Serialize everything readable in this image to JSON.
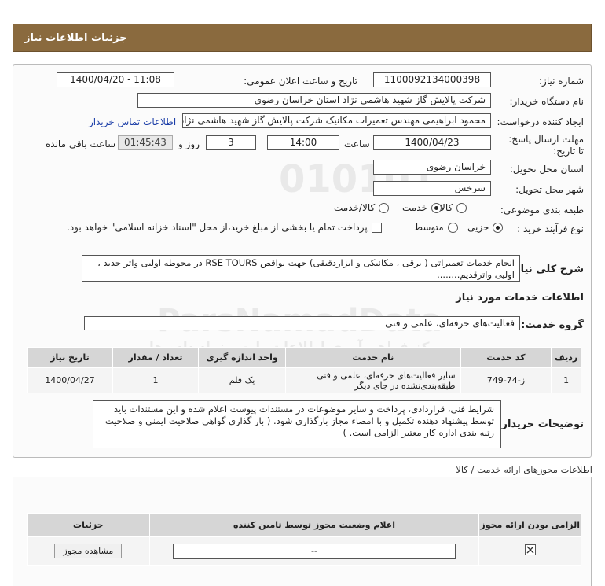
{
  "header": {
    "title": "جزئیات اطلاعات نیاز"
  },
  "fields": {
    "need_number_label": "شماره نیاز:",
    "need_number": "1100092134000398",
    "announce_label": "تاریخ و ساعت اعلان عمومی:",
    "announce_value": "1400/04/20 - 11:08",
    "buyer_label": "نام دستگاه خریدار:",
    "buyer_value": "شرکت پالایش گاز شهید هاشمی نژاد   استان خراسان رضوی",
    "creator_label": "ایجاد کننده درخواست:",
    "creator_value": "محمود ابراهیمی مهندس تعمیرات مکانیک شرکت پالایش گاز شهید هاشمی نژاد",
    "contact_link": "اطلاعات تماس خریدار",
    "deadline_label": "مهلت ارسال پاسخ: تا تاریخ:",
    "deadline_date": "1400/04/23",
    "time_label": "ساعت",
    "deadline_time": "14:00",
    "days_value": "3",
    "days_label": "روز و",
    "remaining_value": "01:45:43",
    "remaining_label": "ساعت باقی مانده",
    "province_label": "استان محل تحویل:",
    "province_value": "خراسان رضوی",
    "city_label": "شهر محل تحویل:",
    "city_value": "سرخس",
    "category_label": "طبقه بندی موضوعی:",
    "category_options": [
      "کالا",
      "خدمت",
      "کالا/خدمت"
    ],
    "category_selected": "خدمت",
    "purchase_label": "نوع فرآیند خرید :",
    "purchase_options": [
      "جزیی",
      "متوسط"
    ],
    "purchase_selected": "جزیی",
    "payment_note": "پرداخت تمام یا بخشی از مبلغ خرید،از محل \"اسناد خزانه اسلامی\" خواهد بود."
  },
  "summary": {
    "label": "شرح کلی نیاز:",
    "text": "انجام خدمات تعمیراتی ( برقی ، مکانیکی و ابزاردقیقی) جهت نواقص RSE TOURS در محوطه اولیی واتر جدید ،  اولیی واترقدیم........"
  },
  "services": {
    "section_title": "اطلاعات خدمات مورد نیاز",
    "group_label": "گروه خدمت:",
    "group_value": "فعالیت‌های حرفه‌ای، علمی و فنی",
    "columns": [
      "ردیف",
      "کد خدمت",
      "نام خدمت",
      "واحد اندازه گیری",
      "تعداد / مقدار",
      "تاریخ نیاز"
    ],
    "rows": [
      {
        "row": "1",
        "code": "ز-74-749",
        "name": "سایر فعالیت‌های حرفه‌ای، علمی و فنی طبقه‌بندی‌نشده در جای دیگر",
        "unit": "یک قلم",
        "qty": "1",
        "date": "1400/04/27"
      }
    ]
  },
  "buyer_notes": {
    "label": "توضیحات خریدار:",
    "text": "شرایط فنی، قراردادی، پرداخت و سایر موضوعات در مستندات پیوست اعلام شده و این مستندات باید توسط پیشنهاد دهنده تکمیل و با امضاء مجاز بارگذاری شود. ( بار گذاری گواهی صلاحیت ایمنی و صلاحیت رتبه بندی اداره کار معتبر الزامی است. )"
  },
  "licenses": {
    "section_title": "اطلاعات مجوزهای ارائه خدمت / کالا",
    "columns": [
      "الزامی بودن ارائه مجوز",
      "اعلام وضعیت مجوز توسط تامین کننده",
      "جزئیات"
    ],
    "rows": [
      {
        "status": "--",
        "action": "مشاهده مجوز"
      }
    ]
  },
  "watermark": {
    "digits": "010101",
    "brand": "ParsNamadData",
    "line1": "مرکز فراهم آوری اطلاعات پارس نماد داده ها",
    "line2": "پایگاه اطلاع رسانی مناقصه ومزایده"
  }
}
